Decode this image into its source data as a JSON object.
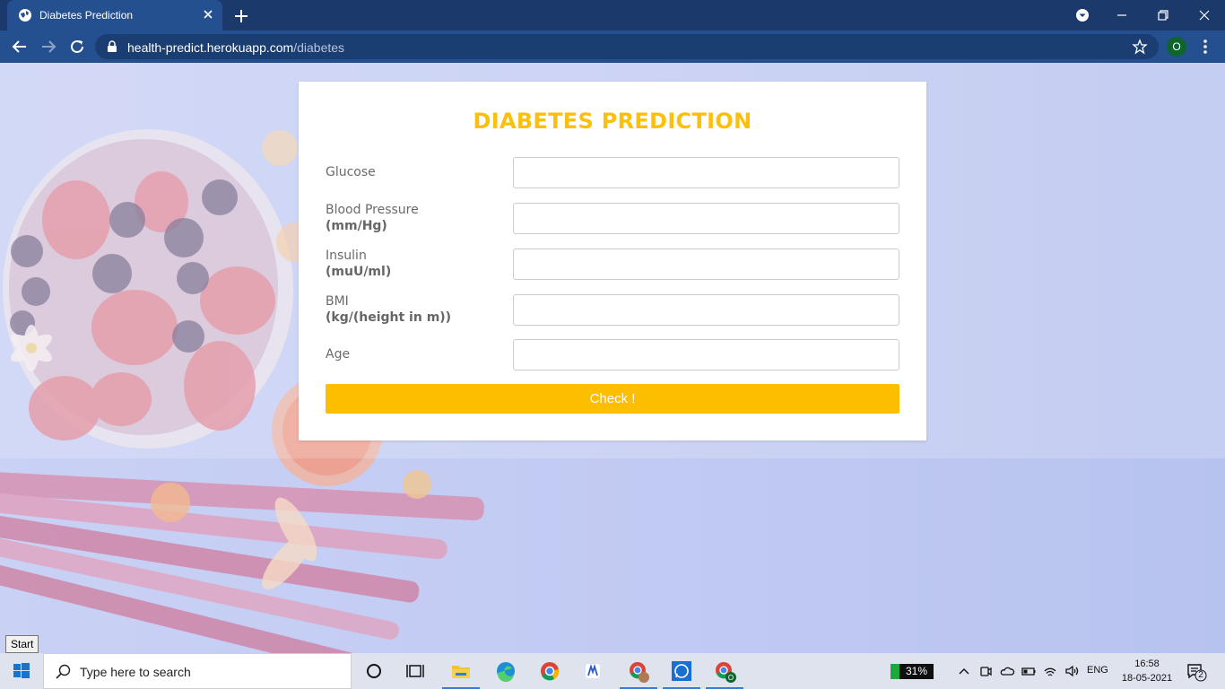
{
  "browser": {
    "tab_title": "Diabetes Prediction",
    "url_host": "health-predict.herokuapp.com",
    "url_path": "/diabetes",
    "profile_initial": "O"
  },
  "page": {
    "title": "DIABETES PREDICTION",
    "fields": [
      {
        "label": "Glucose",
        "unit": "",
        "value": ""
      },
      {
        "label": "Blood Pressure",
        "unit": "(mm/Hg)",
        "value": ""
      },
      {
        "label": "Insulin",
        "unit": "(muU/ml)",
        "value": ""
      },
      {
        "label": "BMI",
        "unit": "(kg/(height in m))",
        "value": ""
      },
      {
        "label": "Age",
        "unit": "",
        "value": ""
      }
    ],
    "submit_label": "Check !",
    "start_tooltip": "Start",
    "accent_color": "#fbbf0d"
  },
  "taskbar": {
    "search_placeholder": "Type here to search",
    "battery_level": "31%",
    "language": "ENG",
    "time": "16:58",
    "date": "18-05-2021",
    "notification_count": "2",
    "apps": [
      "task-view-icon",
      "file-explorer-icon",
      "edge-icon",
      "chrome-icon",
      "app-icon",
      "chrome-profile-icon",
      "whatsapp-icon",
      "chrome-icon"
    ]
  }
}
